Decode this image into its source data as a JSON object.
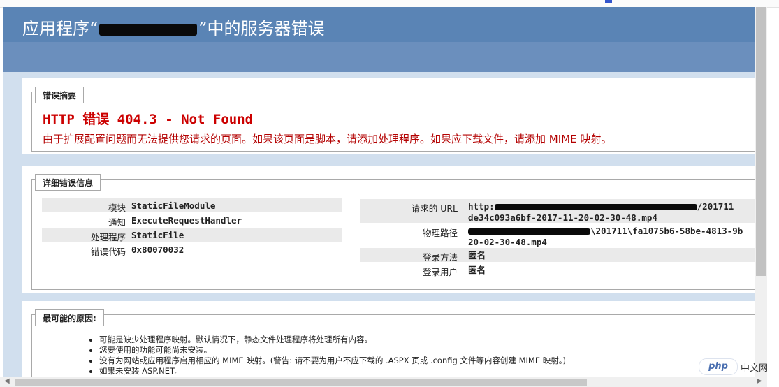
{
  "page": {
    "title_prefix": "应用程序“",
    "title_suffix": "”中的服务器错误"
  },
  "summary": {
    "legend": "错误摘要",
    "error_title": "HTTP 错误 404.3 - Not Found",
    "error_desc": "由于扩展配置问题而无法提供您请求的页面。如果该页面是脚本，请添加处理程序。如果应下载文件，请添加 MIME 映射。"
  },
  "details": {
    "legend": "详细错误信息",
    "left": [
      {
        "label": "模块",
        "value": "StaticFileModule"
      },
      {
        "label": "通知",
        "value": "ExecuteRequestHandler"
      },
      {
        "label": "处理程序",
        "value": "StaticFile"
      },
      {
        "label": "错误代码",
        "value": "0x80070032"
      }
    ],
    "right": {
      "url_label": "请求的 URL",
      "url_line1_start": "http:",
      "url_line1_end": "/201711",
      "url_line2": "de34c093a6bf-2017-11-20-02-30-48.mp4",
      "path_label": "物理路径",
      "path_line1_end": "\\201711\\fa1075b6-58be-4813-9b",
      "path_line2": "20-02-30-48.mp4",
      "logon_method_label": "登录方法",
      "logon_method_value": "匿名",
      "logon_user_label": "登录用户",
      "logon_user_value": "匿名"
    }
  },
  "causes": {
    "legend": "最可能的原因:",
    "items": [
      "可能是缺少处理程序映射。默认情况下，静态文件处理程序将处理所有内容。",
      "您要使用的功能可能尚未安装。",
      "没有为网站或应用程序启用相应的 MIME 映射。(警告: 请不要为用户不应下载的 .ASPX 页或 .config 文件等内容创建 MIME 映射。)",
      "如果未安装 ASP.NET。"
    ]
  },
  "watermark": {
    "logo": "php",
    "text": "中文网"
  }
}
